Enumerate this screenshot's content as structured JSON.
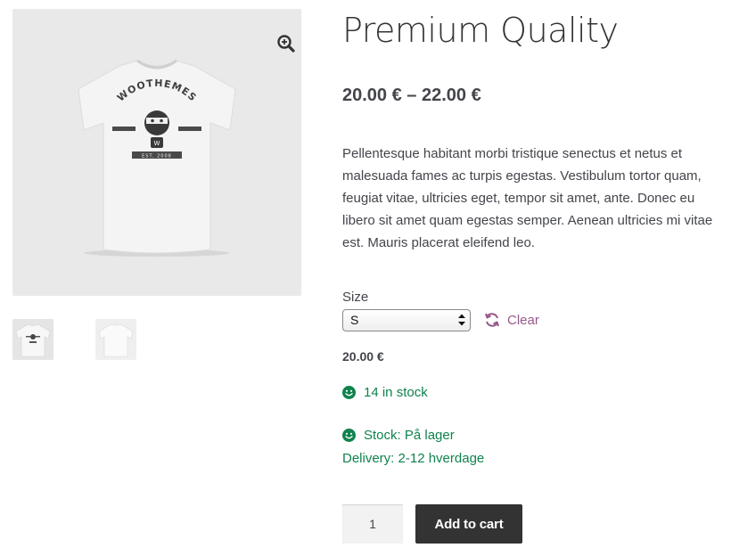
{
  "product": {
    "title": "Premium Quality",
    "price_range": "20.00 € – 22.00 €",
    "description": "Pellentesque habitant morbi tristique senectus et netus et malesuada fames ac turpis egestas. Vestibulum tortor quam, feugiat vitae, ultricies eget, tempor sit amet, ante. Donec eu libero sit amet quam egestas semper. Aenean ultricies mi vitae est. Mauris placerat eleifend leo.",
    "image_text": "WOOTHEMES",
    "image_badge": "W",
    "image_banner": "EST. 2008"
  },
  "variation": {
    "size_label": "Size",
    "size_selected": "S",
    "clear_label": "Clear",
    "price": "20.00 €",
    "stock_text": "14 in stock",
    "stock_status": "Stock: På lager",
    "delivery": "Delivery: 2-12 hverdage"
  },
  "cart": {
    "quantity": "1",
    "add_to_cart_label": "Add to cart"
  },
  "icons": {
    "zoom": "zoom-in-icon",
    "clear": "refresh-icon",
    "stock": "smiley-icon"
  },
  "colors": {
    "accent": "#96588a",
    "stock_green": "#0f834d",
    "button_dark": "#333333"
  }
}
